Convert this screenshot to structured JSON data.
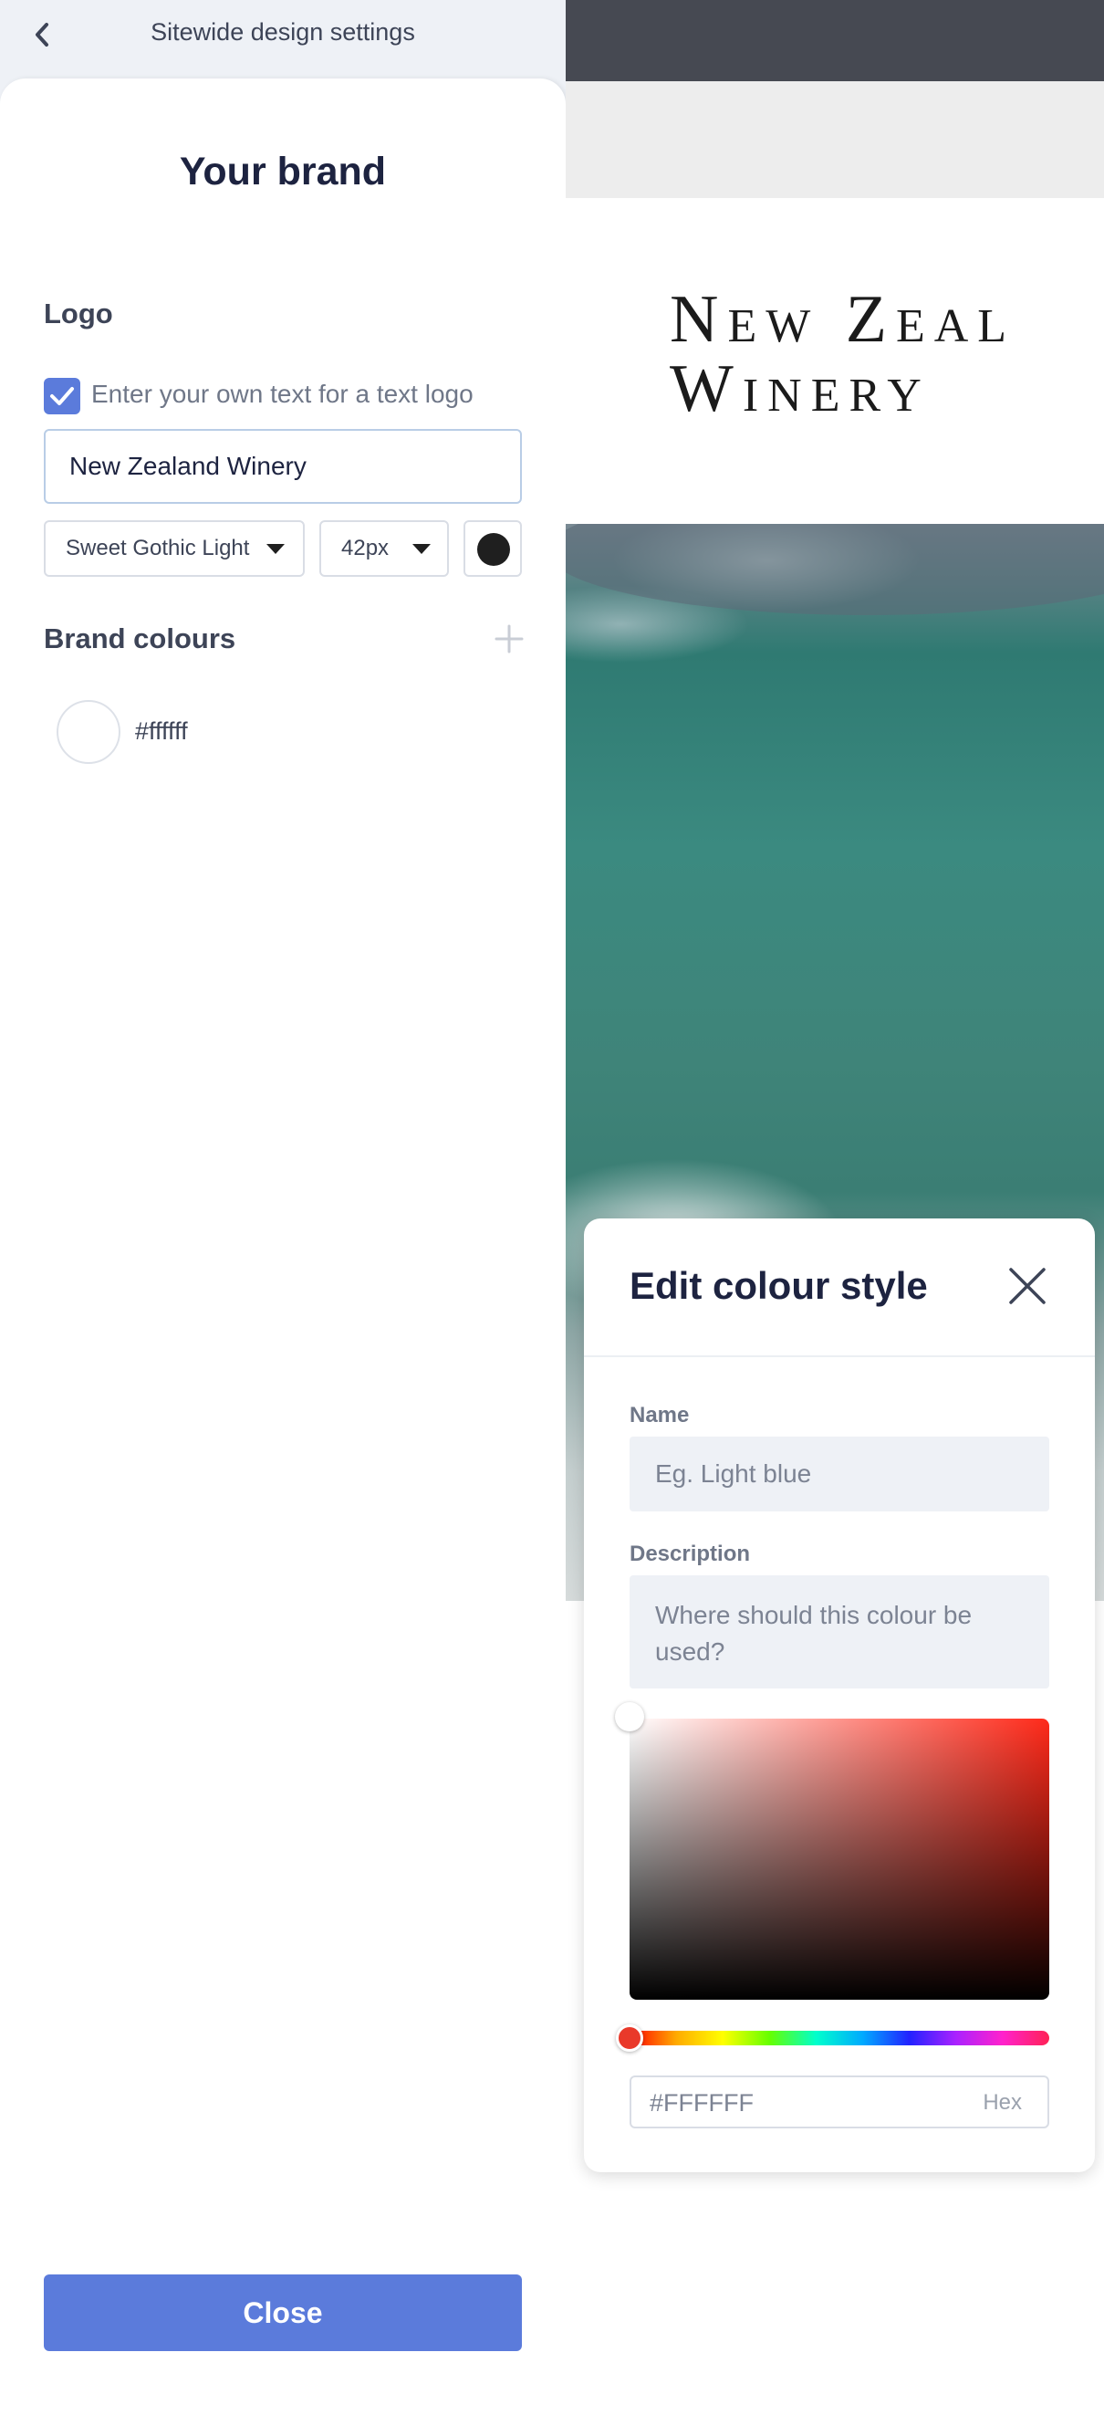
{
  "header": {
    "title": "Sitewide design settings",
    "back_icon": "chevron-left-icon"
  },
  "brand": {
    "title": "Your brand",
    "logo_section_label": "Logo",
    "text_logo_checkbox_label": "Enter your own text for a text logo",
    "text_logo_checked": true,
    "logo_text_value": "New Zealand Winery",
    "font_family_selected": "Sweet Gothic Light",
    "font_size_selected": "42px",
    "logo_color": "#1f1f1f",
    "colours_section_label": "Brand colours",
    "colours": [
      {
        "hex": "#ffffff"
      }
    ],
    "close_label": "Close"
  },
  "preview": {
    "site_logo_line1": "New Zeal",
    "site_logo_line2": "Winery",
    "topbar_color": "#464952"
  },
  "edit_colour_popover": {
    "title": "Edit colour style",
    "name_label": "Name",
    "name_placeholder": "Eg. Light blue",
    "description_label": "Description",
    "description_placeholder": "Where should this colour be used?",
    "hex_value": "#FFFFFF",
    "hex_suffix": "Hex",
    "hue_color": "#e9392a"
  },
  "accent_color": "#5b7bdb"
}
